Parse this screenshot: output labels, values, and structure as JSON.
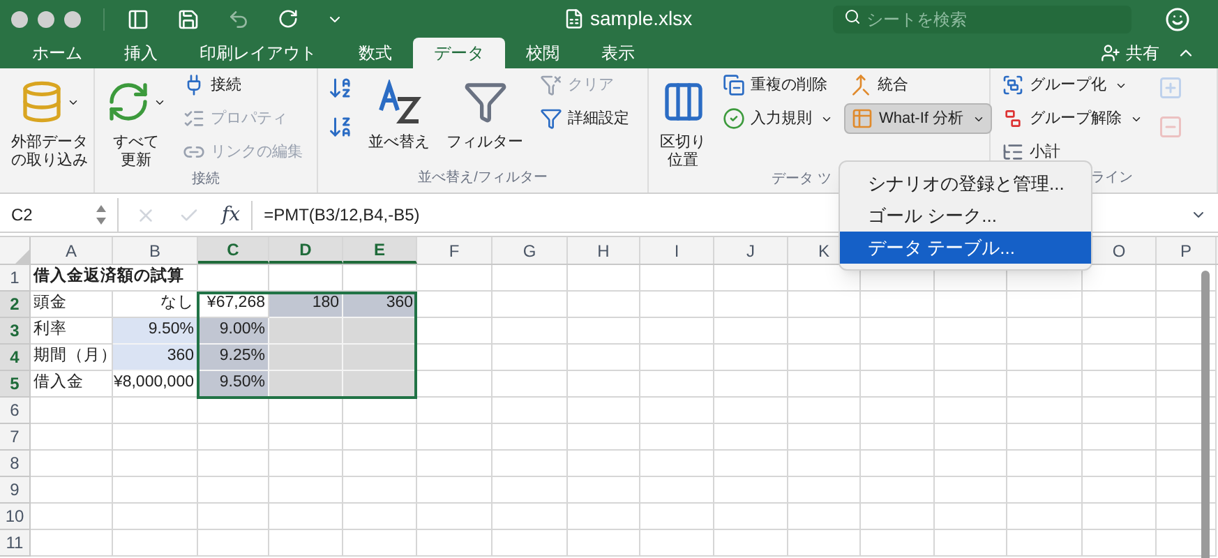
{
  "window": {
    "title": "sample.xlsx",
    "search": {
      "placeholder": "シートを検索"
    }
  },
  "tabs": [
    {
      "label": "ホーム",
      "selected": false
    },
    {
      "label": "挿入",
      "selected": false
    },
    {
      "label": "印刷レイアウト",
      "selected": false
    },
    {
      "label": "数式",
      "selected": false
    },
    {
      "label": "データ",
      "selected": true
    },
    {
      "label": "校閲",
      "selected": false
    },
    {
      "label": "表示",
      "selected": false
    }
  ],
  "share": {
    "label": "共有"
  },
  "ribbon": {
    "groups": [
      {
        "columns": [
          [
            {
              "kind": "large",
              "label": [
                "外部データ",
                "の取り込み"
              ],
              "dropdown": true,
              "disabled": false
            }
          ]
        ]
      },
      {
        "label": "接続",
        "columns": [
          [
            {
              "kind": "large",
              "label": [
                "すべて",
                "更新"
              ],
              "dropdown": true,
              "disabled": false
            }
          ],
          [
            {
              "kind": "small",
              "label": "接続",
              "disabled": false
            },
            {
              "kind": "small",
              "label": "プロパティ",
              "disabled": true
            },
            {
              "kind": "small",
              "label": "リンクの編集",
              "disabled": true
            }
          ]
        ]
      },
      {
        "label": "並べ替え/フィルター",
        "columns": [
          [
            {
              "kind": "icon",
              "disabled": false
            },
            {
              "kind": "icon",
              "disabled": false
            }
          ],
          [
            {
              "kind": "large",
              "label": [
                "並べ替え"
              ],
              "disabled": false
            }
          ],
          [
            {
              "kind": "large",
              "label": [
                "フィルター"
              ],
              "disabled": false
            }
          ],
          [
            {
              "kind": "small",
              "label": "クリア",
              "disabled": true
            },
            {
              "kind": "small",
              "label": "詳細設定",
              "disabled": false
            }
          ]
        ]
      },
      {
        "label": "データ ツ",
        "columns": [
          [
            {
              "kind": "large",
              "label": [
                "区切り",
                "位置"
              ],
              "disabled": false
            }
          ],
          [
            {
              "kind": "small",
              "label": "重複の削除",
              "disabled": false
            },
            {
              "kind": "small",
              "label": "入力規則",
              "dropdown": true,
              "disabled": false
            }
          ],
          [
            {
              "kind": "small",
              "label": "統合",
              "disabled": false
            },
            {
              "kind": "small",
              "label": "What-If 分析",
              "dropdown": true,
              "pressed": true,
              "disabled": false
            }
          ]
        ]
      },
      {
        "label": "ライン",
        "columns": [
          [
            {
              "kind": "small",
              "label": "グループ化",
              "dropdown": true,
              "disabled": false
            },
            {
              "kind": "small",
              "label": "グループ解除",
              "dropdown": true,
              "disabled": false
            },
            {
              "kind": "small",
              "label": "小計",
              "disabled": false
            }
          ],
          [
            {
              "kind": "icon",
              "disabled": true
            },
            {
              "kind": "icon",
              "disabled": true
            }
          ]
        ]
      }
    ]
  },
  "menu": {
    "items": [
      {
        "label": "シナリオの登録と管理...",
        "selected": false
      },
      {
        "label": "ゴール シーク...",
        "selected": false
      },
      {
        "label": "データ テーブル...",
        "selected": true
      }
    ]
  },
  "formula_bar": {
    "name_box": "C2",
    "function_label": "fx",
    "formula": "=PMT(B3/12,B4,-B5)"
  },
  "sheet": {
    "columns": [
      {
        "label": "A",
        "selected": false
      },
      {
        "label": "B",
        "selected": false
      },
      {
        "label": "C",
        "selected": true
      },
      {
        "label": "D",
        "selected": true
      },
      {
        "label": "E",
        "selected": true
      },
      {
        "label": "F",
        "selected": false
      },
      {
        "label": "G",
        "selected": false
      },
      {
        "label": "H",
        "selected": false
      },
      {
        "label": "I",
        "selected": false
      },
      {
        "label": "J",
        "selected": false
      },
      {
        "label": "K",
        "selected": false
      },
      {},
      {},
      {},
      {
        "label": "O",
        "selected": false
      },
      {
        "label": "P",
        "selected": false
      }
    ],
    "rows": [
      {
        "header": "1",
        "selected": false,
        "cells": [
          {
            "text": "借入金返済額の試算",
            "bold": true
          }
        ]
      },
      {
        "header": "2",
        "selected": true,
        "cells": [
          {
            "text": "頭金"
          },
          {
            "text": "なし",
            "align_right": true
          },
          {
            "text": "¥67,268",
            "align_right": true
          },
          {
            "text": "180",
            "align_right": true,
            "color": "#c1c6d2"
          },
          {
            "text": "360",
            "align_right": true,
            "color": "#c1c6d2"
          }
        ]
      },
      {
        "header": "3",
        "selected": true,
        "cells": [
          {
            "text": "利率"
          },
          {
            "text": "9.50%",
            "align_right": true,
            "color": "#dae3f3"
          },
          {
            "text": "9.00%",
            "align_right": true,
            "color": "#c1c6d2"
          },
          {
            "color": "#d9d9d9"
          },
          {
            "color": "#d9d9d9"
          }
        ]
      },
      {
        "header": "4",
        "selected": true,
        "cells": [
          {
            "text": "期間（月）"
          },
          {
            "text": "360",
            "align_right": true,
            "color": "#dae3f3"
          },
          {
            "text": "9.25%",
            "align_right": true,
            "color": "#c1c6d2"
          },
          {
            "color": "#d9d9d9"
          },
          {
            "color": "#d9d9d9"
          }
        ]
      },
      {
        "header": "5",
        "selected": true,
        "cells": [
          {
            "text": "借入金"
          },
          {
            "text": "¥8,000,000",
            "align_right": true
          },
          {
            "text": "9.50%",
            "align_right": true,
            "color": "#c1c6d2"
          },
          {
            "color": "#d9d9d9"
          },
          {
            "color": "#d9d9d9"
          }
        ]
      },
      {
        "header": "6",
        "selected": false,
        "cells": []
      },
      {
        "header": "7",
        "selected": false,
        "cells": []
      },
      {
        "header": "8",
        "selected": false,
        "cells": []
      },
      {
        "header": "9",
        "selected": false,
        "cells": []
      },
      {
        "header": "10",
        "selected": false,
        "cells": []
      },
      {
        "header": "11",
        "selected": false,
        "cells": []
      }
    ]
  }
}
